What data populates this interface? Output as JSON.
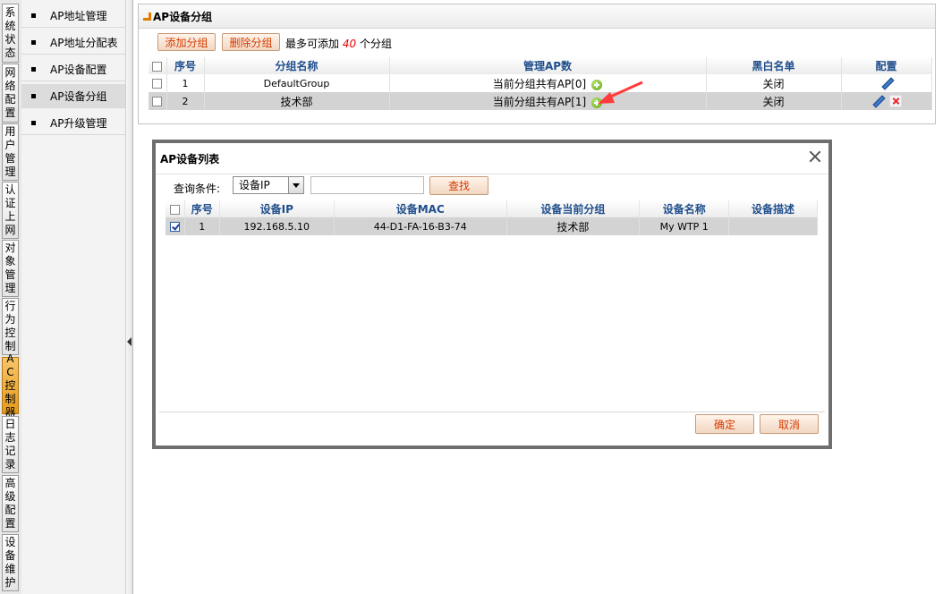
{
  "left_tabs": [
    {
      "label": "系统状态",
      "active": false
    },
    {
      "label": "网络配置",
      "active": false
    },
    {
      "label": "用户管理",
      "active": false
    },
    {
      "label": "认证上网",
      "active": false
    },
    {
      "label": "对象管理",
      "active": false
    },
    {
      "label": "行为控制",
      "active": false
    },
    {
      "label": "AC控制器",
      "active": true
    },
    {
      "label": "日志记录",
      "active": false
    },
    {
      "label": "高级配置",
      "active": false
    },
    {
      "label": "设备维护",
      "active": false
    }
  ],
  "submenu": [
    {
      "label": "AP地址管理"
    },
    {
      "label": "AP地址分配表"
    },
    {
      "label": "AP设备配置"
    },
    {
      "label": "AP设备分组",
      "active": true
    },
    {
      "label": "AP升级管理"
    }
  ],
  "panel": {
    "title": "AP设备分组",
    "add_button": "添加分组",
    "delete_button": "删除分组",
    "limit_prefix": "最多可添加",
    "limit_value": "40",
    "limit_suffix": "个分组",
    "headers": [
      "序号",
      "分组名称",
      "管理AP数",
      "黑白名单",
      "配置"
    ],
    "rows": [
      {
        "index": "1",
        "name": "DefaultGroup",
        "ap_count": "当前分组共有AP[0]",
        "list": "关闭"
      },
      {
        "index": "2",
        "name": "技术部",
        "ap_count": "当前分组共有AP[1]",
        "list": "关闭"
      }
    ]
  },
  "dialog": {
    "title": "AP设备列表",
    "query_label": "查询条件:",
    "query_select": "设备IP",
    "query_input": "",
    "search_button": "查找",
    "headers": [
      "序号",
      "设备IP",
      "设备MAC",
      "设备当前分组",
      "设备名称",
      "设备描述"
    ],
    "rows": [
      {
        "checked": true,
        "index": "1",
        "ip": "192.168.5.10",
        "mac": "44-D1-FA-16-B3-74",
        "group": "技术部",
        "name": "My WTP 1",
        "desc": ""
      }
    ],
    "ok_button": "确定",
    "cancel_button": "取消"
  },
  "colors": {
    "accent": "#e59a1c",
    "header_text": "#1f4e8c",
    "button_text": "#d43a00",
    "arrow": "#ff3b3b"
  }
}
